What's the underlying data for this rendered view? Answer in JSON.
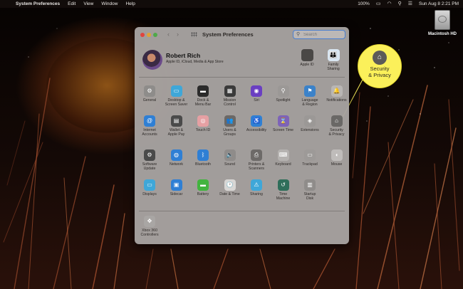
{
  "menubar": {
    "app_name": "System Preferences",
    "items": [
      "Edit",
      "View",
      "Window",
      "Help"
    ],
    "battery": "100%",
    "datetime": "Sun Aug 8  2:21 PM"
  },
  "desktop": {
    "disk_label": "Macintosh HD"
  },
  "window": {
    "title": "System Preferences",
    "search_placeholder": "Search"
  },
  "account": {
    "name": "Robert Rich",
    "subtitle": "Apple ID, iCloud, Media & App Store",
    "apple_id_label": "Apple ID",
    "family_label": "Family\nSharing"
  },
  "prefs": {
    "row1": [
      {
        "label": "General",
        "icon": "general-icon",
        "color": "#8e8c8a",
        "glyph": "⚙"
      },
      {
        "label": "Desktop &\nScreen Saver",
        "icon": "desktop-icon",
        "color": "#3fa7d8",
        "glyph": "▭"
      },
      {
        "label": "Dock &\nMenu Bar",
        "icon": "dock-icon",
        "color": "#2b2b2b",
        "glyph": "▬"
      },
      {
        "label": "Mission\nControl",
        "icon": "mission-control-icon",
        "color": "#3a3a3a",
        "glyph": "▦"
      },
      {
        "label": "Siri",
        "icon": "siri-icon",
        "color": "#6a3fc2",
        "glyph": "◉"
      },
      {
        "label": "Spotlight",
        "icon": "spotlight-icon",
        "color": "#9b9896",
        "glyph": "⚲"
      },
      {
        "label": "Language\n& Region",
        "icon": "globe-flag-icon",
        "color": "#3b82c9",
        "glyph": "⚑"
      },
      {
        "label": "Notifications",
        "icon": "notifications-icon",
        "color": "#b9b6b4",
        "glyph": "🔔"
      }
    ],
    "row2": [
      {
        "label": "Internet\nAccounts",
        "icon": "at-sign-icon",
        "color": "#2f7fd4",
        "glyph": "@"
      },
      {
        "label": "Wallet &\nApple Pay",
        "icon": "wallet-icon",
        "color": "#4a4a4a",
        "glyph": "▤"
      },
      {
        "label": "Touch ID",
        "icon": "fingerprint-icon",
        "color": "#e5a0a3",
        "glyph": "◎"
      },
      {
        "label": "Users &\nGroups",
        "icon": "users-icon",
        "color": "#6b6866",
        "glyph": "👥"
      },
      {
        "label": "Accessibility",
        "icon": "accessibility-icon",
        "color": "#2f7fd4",
        "glyph": "♿"
      },
      {
        "label": "Screen Time",
        "icon": "hourglass-icon",
        "color": "#7d63b8",
        "glyph": "⌛"
      },
      {
        "label": "Extensions",
        "icon": "puzzle-icon",
        "color": "#9b9896",
        "glyph": "◈"
      },
      {
        "label": "Security\n& Privacy",
        "icon": "house-lock-icon",
        "color": "#6a6866",
        "glyph": "⌂"
      }
    ],
    "row3": [
      {
        "label": "Software\nUpdate",
        "icon": "gear-update-icon",
        "color": "#4a4a4a",
        "glyph": "⚙"
      },
      {
        "label": "Network",
        "icon": "globe-icon",
        "color": "#2f7fd4",
        "glyph": "◍"
      },
      {
        "label": "Bluetooth",
        "icon": "bluetooth-icon",
        "color": "#2f7fd4",
        "glyph": "ᛒ"
      },
      {
        "label": "Sound",
        "icon": "speaker-icon",
        "color": "#8f8c8a",
        "glyph": "🔈"
      },
      {
        "label": "Printers &\nScanners",
        "icon": "printer-icon",
        "color": "#6d6a68",
        "glyph": "⎙"
      },
      {
        "label": "Keyboard",
        "icon": "keyboard-icon",
        "color": "#b5b2b0",
        "glyph": "⌨"
      },
      {
        "label": "Trackpad",
        "icon": "trackpad-icon",
        "color": "#9d9a98",
        "glyph": "▭"
      },
      {
        "label": "Mouse",
        "icon": "mouse-icon",
        "color": "#bfbcba",
        "glyph": "◖"
      }
    ],
    "row4": [
      {
        "label": "Displays",
        "icon": "display-icon",
        "color": "#3fa7d8",
        "glyph": "▭"
      },
      {
        "label": "Sidecar",
        "icon": "sidecar-icon",
        "color": "#2f7fd4",
        "glyph": "▣"
      },
      {
        "label": "Battery",
        "icon": "battery-icon",
        "color": "#42b43f",
        "glyph": "▬"
      },
      {
        "label": "Date & Time",
        "icon": "clock-icon",
        "color": "#d8d6d4",
        "glyph": "🕑"
      },
      {
        "label": "Sharing",
        "icon": "sharing-folder-icon",
        "color": "#3fa7d8",
        "glyph": "⚠"
      },
      {
        "label": "Time\nMachine",
        "icon": "time-machine-icon",
        "color": "#2f6e5a",
        "glyph": "↺"
      },
      {
        "label": "Startup\nDisk",
        "icon": "startup-disk-icon",
        "color": "#8f8c8a",
        "glyph": "▥"
      }
    ],
    "other": [
      {
        "label": "Xbox 360\nControllers",
        "icon": "xbox-controller-icon",
        "color": "#a9a6a4",
        "glyph": "✥"
      }
    ]
  },
  "callout": {
    "label": "Security\n& Privacy",
    "icon": "house-lock-icon"
  },
  "colors": {
    "callout": "#fbf05a",
    "search_focus": "#4a7fd0",
    "window_bg": "#a8a3a1"
  }
}
